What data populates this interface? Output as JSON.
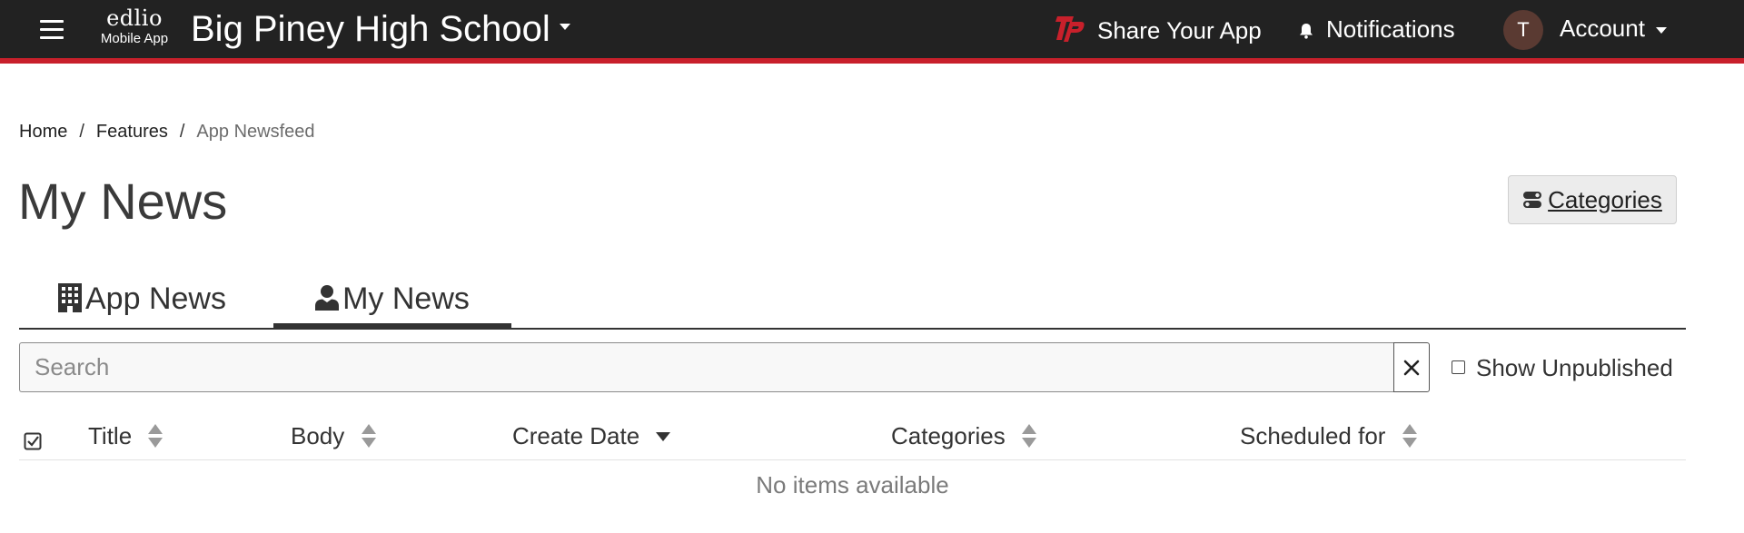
{
  "header": {
    "brand_name": "edlio",
    "brand_sub": "Mobile App",
    "school": "Big Piney High School",
    "share_label": "Share Your App",
    "notifications_label": "Notifications",
    "avatar_initial": "T",
    "account_label": "Account",
    "accent_color": "#c8202b",
    "bar_color": "#222222"
  },
  "breadcrumb": {
    "items": [
      "Home",
      "Features",
      "App Newsfeed"
    ],
    "separator": "/"
  },
  "page": {
    "title": "My News",
    "categories_button": "Categories"
  },
  "tabs": [
    {
      "label": "App News",
      "icon": "building-icon",
      "active": false
    },
    {
      "label": "My News",
      "icon": "user-icon",
      "active": true
    }
  ],
  "search": {
    "placeholder": "Search",
    "value": "",
    "clear_icon": "close-icon"
  },
  "filters": {
    "show_unpublished_label": "Show Unpublished",
    "show_unpublished_checked": false
  },
  "table": {
    "columns": [
      {
        "label": "Title",
        "sort": "none"
      },
      {
        "label": "Body",
        "sort": "none"
      },
      {
        "label": "Create Date",
        "sort": "desc"
      },
      {
        "label": "Categories",
        "sort": "none"
      },
      {
        "label": "Scheduled for",
        "sort": "none"
      }
    ],
    "empty_message": "No items available"
  }
}
